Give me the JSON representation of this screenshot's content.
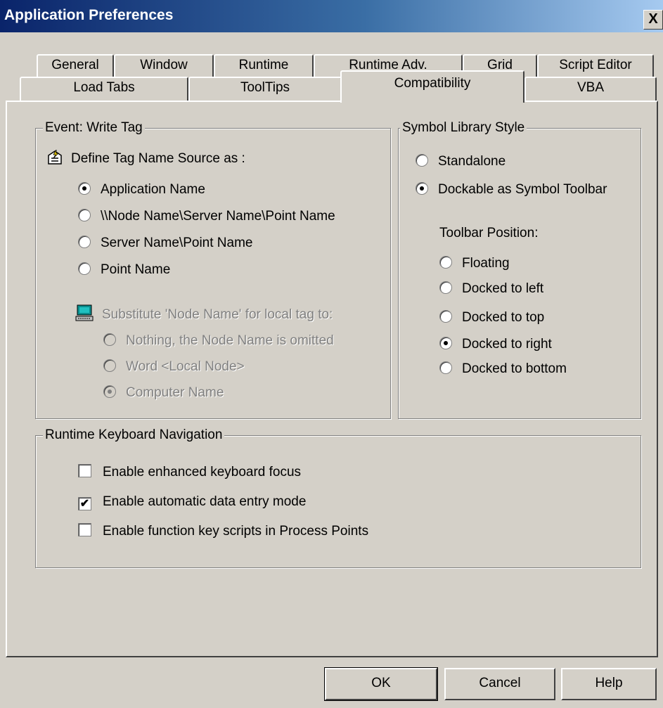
{
  "window": {
    "title": "Application Preferences",
    "close_glyph": "X"
  },
  "tabs_row1": [
    "General",
    "Window",
    "Runtime",
    "Runtime Adv.",
    "Grid",
    "Script Editor"
  ],
  "tabs_row2": [
    "Load Tabs",
    "ToolTips",
    "Compatibility",
    "VBA"
  ],
  "selected_tab": "Compatibility",
  "event_group": {
    "legend": "Event: Write Tag",
    "define_label": "Define Tag Name Source as :",
    "options": [
      {
        "label": "Application Name",
        "selected": true
      },
      {
        "label": "\\\\Node Name\\Server Name\\Point Name",
        "selected": false
      },
      {
        "label": "Server Name\\Point Name",
        "selected": false
      },
      {
        "label": "Point Name",
        "selected": false
      }
    ],
    "substitute_label": "Substitute 'Node Name'  for local tag to:",
    "sub_options": [
      {
        "label": "Nothing, the Node Name is omitted",
        "selected": false
      },
      {
        "label": "Word  <Local Node>",
        "selected": false
      },
      {
        "label": "Computer Name",
        "selected": true
      }
    ]
  },
  "symbol_group": {
    "legend": "Symbol Library Style",
    "options": [
      {
        "label": "Standalone",
        "selected": false
      },
      {
        "label": "Dockable as Symbol Toolbar",
        "selected": true
      }
    ],
    "toolbar_position_label": "Toolbar Position:",
    "positions": [
      {
        "label": "Floating",
        "selected": false
      },
      {
        "label": "Docked to left",
        "selected": false
      },
      {
        "label": "Docked to top",
        "selected": false
      },
      {
        "label": "Docked to right",
        "selected": true
      },
      {
        "label": "Docked to bottom",
        "selected": false
      }
    ]
  },
  "keyboard_group": {
    "legend": "Runtime Keyboard Navigation",
    "checks": [
      {
        "label": "Enable enhanced keyboard focus",
        "checked": false
      },
      {
        "label": "Enable automatic data entry mode",
        "checked": true
      },
      {
        "label": "Enable function key scripts in Process Points",
        "checked": false
      }
    ]
  },
  "buttons": {
    "ok": "OK",
    "cancel": "Cancel",
    "help": "Help"
  }
}
